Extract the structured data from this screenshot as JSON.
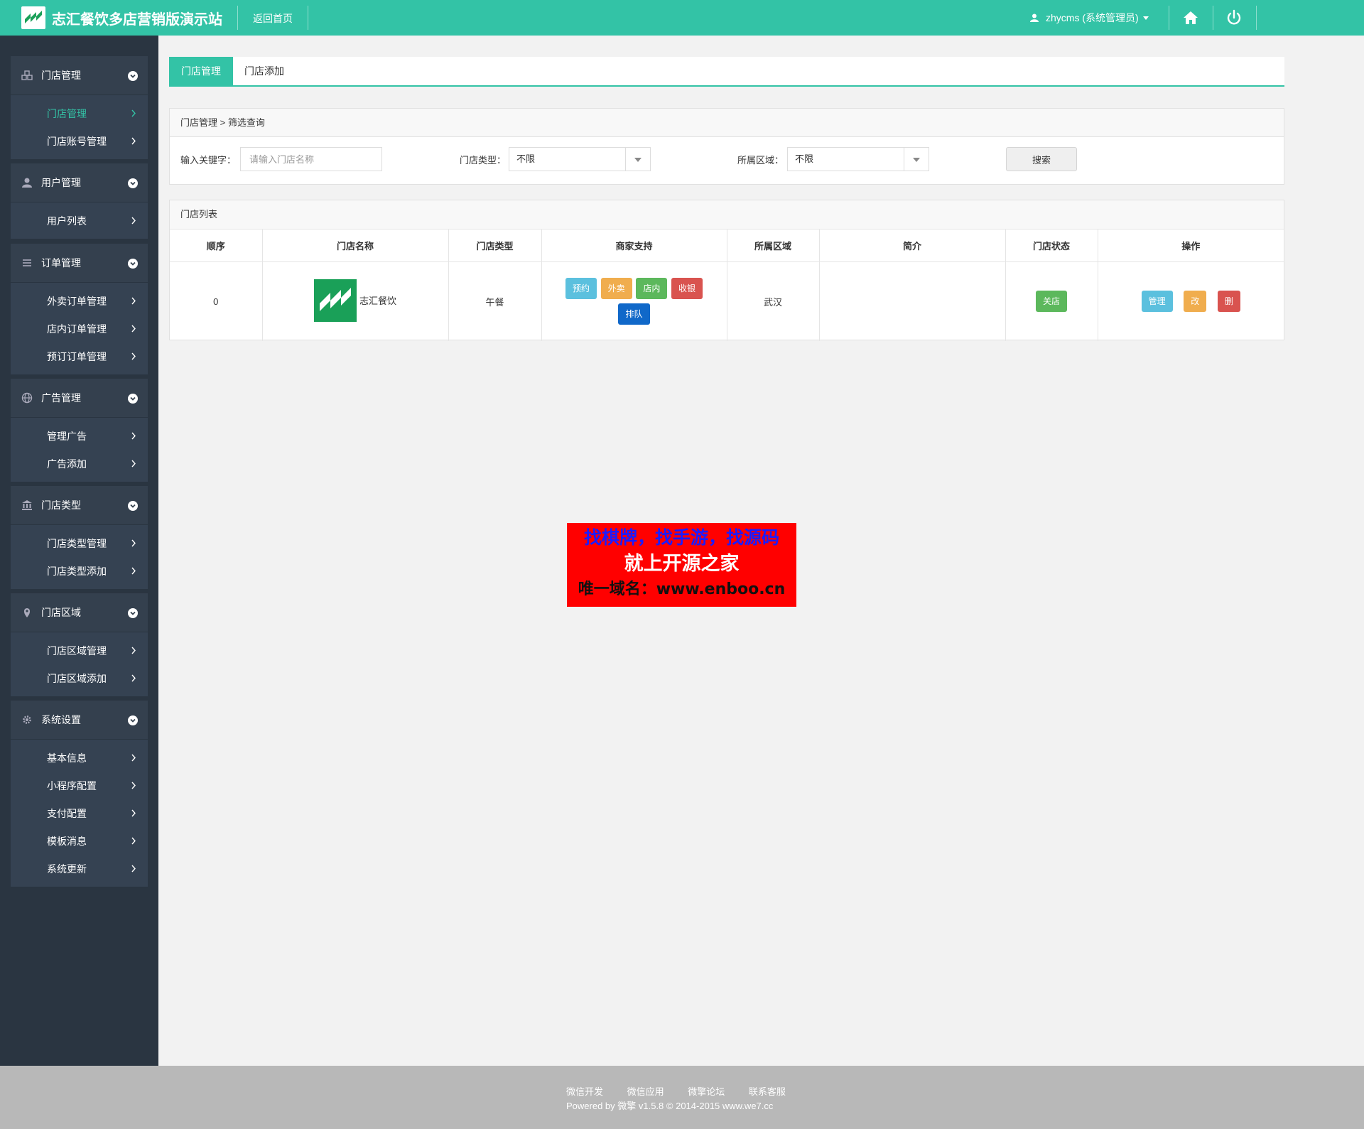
{
  "header": {
    "title": "志汇餐饮多店营销版演示站",
    "back_home": "返回首页",
    "user": "zhycms (系统管理员)",
    "logo_icon": "zh-logo-icon",
    "home_icon": "home-icon",
    "power_icon": "power-icon"
  },
  "sidebar": {
    "groups": [
      {
        "title": "门店管理",
        "icon": "cubes-icon",
        "items": [
          "门店管理",
          "门店账号管理"
        ]
      },
      {
        "title": "用户管理",
        "icon": "user-icon",
        "items": [
          "用户列表"
        ]
      },
      {
        "title": "订单管理",
        "icon": "list-icon",
        "items": [
          "外卖订单管理",
          "店内订单管理",
          "预订订单管理"
        ]
      },
      {
        "title": "广告管理",
        "icon": "globe-icon",
        "items": [
          "管理广告",
          "广告添加"
        ]
      },
      {
        "title": "门店类型",
        "icon": "bank-icon",
        "items": [
          "门店类型管理",
          "门店类型添加"
        ]
      },
      {
        "title": "门店区域",
        "icon": "map-marker-icon",
        "items": [
          "门店区域管理",
          "门店区域添加"
        ]
      },
      {
        "title": "系统设置",
        "icon": "cog-icon",
        "items": [
          "基本信息",
          "小程序配置",
          "支付配置",
          "模板消息",
          "系统更新"
        ]
      }
    ]
  },
  "tabs": [
    "门店管理",
    "门店添加"
  ],
  "filter": {
    "breadcrumb": "门店管理 > 筛选查询",
    "keyword_label": "输入关键字：",
    "keyword_placeholder": "请输入门店名称",
    "type_label": "门店类型：",
    "type_value": "不限",
    "region_label": "所属区域：",
    "region_value": "不限",
    "search_button": "搜索"
  },
  "list": {
    "title": "门店列表",
    "columns": [
      "顺序",
      "门店名称",
      "门店类型",
      "商家支持",
      "所属区域",
      "简介",
      "门店状态",
      "操作"
    ],
    "rows": [
      {
        "order": "0",
        "name": "志汇餐饮",
        "type": "午餐",
        "support": [
          "预约",
          "外卖",
          "店内",
          "收银",
          "排队"
        ],
        "region": "武汉",
        "intro": "",
        "status": "关店",
        "actions": [
          "管理",
          "改",
          "删"
        ]
      }
    ]
  },
  "ad": {
    "line1": "找棋牌，找手游，找源码",
    "line2": "就上开源之家",
    "line3": "唯一域名：www.enboo.cn"
  },
  "footer": {
    "links": [
      "微信开发",
      "微信应用",
      "微擎论坛",
      "联系客服"
    ],
    "copyright": "Powered by 微擎 v1.5.8 © 2014-2015 www.we7.cc"
  },
  "colors": {
    "accent": "#33c3a6",
    "sidebar_bg": "#2a3541",
    "info": "#5bc0de",
    "warning": "#f0ad4e",
    "success": "#5cb85c",
    "danger": "#d9534f",
    "primary": "#1068c9"
  }
}
